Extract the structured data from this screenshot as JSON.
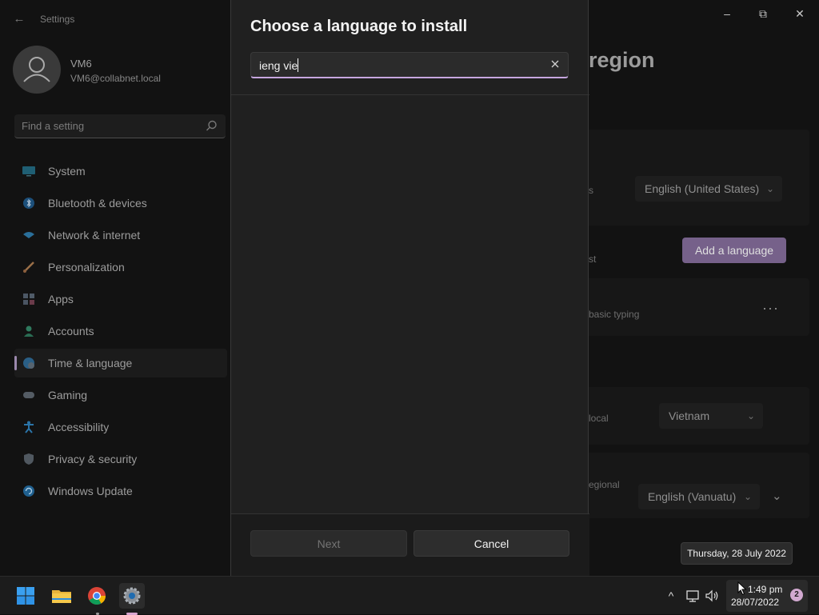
{
  "window": {
    "title": "Settings",
    "back_glyph": "←",
    "minimize_glyph": "–",
    "maximize_glyph": "⧉",
    "close_glyph": "✕"
  },
  "user": {
    "name": "VM6",
    "email": "VM6@collabnet.local"
  },
  "search": {
    "placeholder": "Find a setting"
  },
  "sidebar": {
    "items": [
      {
        "label": "System",
        "icon": "monitor-icon"
      },
      {
        "label": "Bluetooth & devices",
        "icon": "bluetooth-icon"
      },
      {
        "label": "Network & internet",
        "icon": "wifi-icon"
      },
      {
        "label": "Personalization",
        "icon": "brush-icon"
      },
      {
        "label": "Apps",
        "icon": "apps-icon"
      },
      {
        "label": "Accounts",
        "icon": "person-icon"
      },
      {
        "label": "Time & language",
        "icon": "globe-clock-icon",
        "active": true
      },
      {
        "label": "Gaming",
        "icon": "gamepad-icon"
      },
      {
        "label": "Accessibility",
        "icon": "accessibility-icon"
      },
      {
        "label": "Privacy & security",
        "icon": "shield-icon"
      },
      {
        "label": "Windows Update",
        "icon": "update-icon"
      }
    ]
  },
  "content": {
    "page_title": "region",
    "display_language_label": "s",
    "display_language_value": "English (United States)",
    "preferred_languages_label": "st",
    "add_language_label": "Add a language",
    "language_entry_note": "basic typing",
    "more_options": "···",
    "country_label": "local",
    "country_value": "Vietnam",
    "regional_format_label": "egional",
    "regional_format_value": "English (Vanuatu)",
    "chevron_glyph": "⌄",
    "expand_glyph": "⌄"
  },
  "dialog": {
    "title": "Choose a language to install",
    "search_value": "ieng vie",
    "clear_glyph": "✕",
    "next_label": "Next",
    "cancel_label": "Cancel"
  },
  "tooltip": {
    "text": "Thursday, 28 July 2022"
  },
  "taskbar": {
    "show_hidden_glyph": "^",
    "volume_glyph": "🔊",
    "time": "1:49 pm",
    "date": "28/07/2022",
    "notification_count": "2"
  },
  "colors": {
    "accent": "#76618a",
    "input_focus": "#c6a6df",
    "dialog_bg": "#202020"
  }
}
